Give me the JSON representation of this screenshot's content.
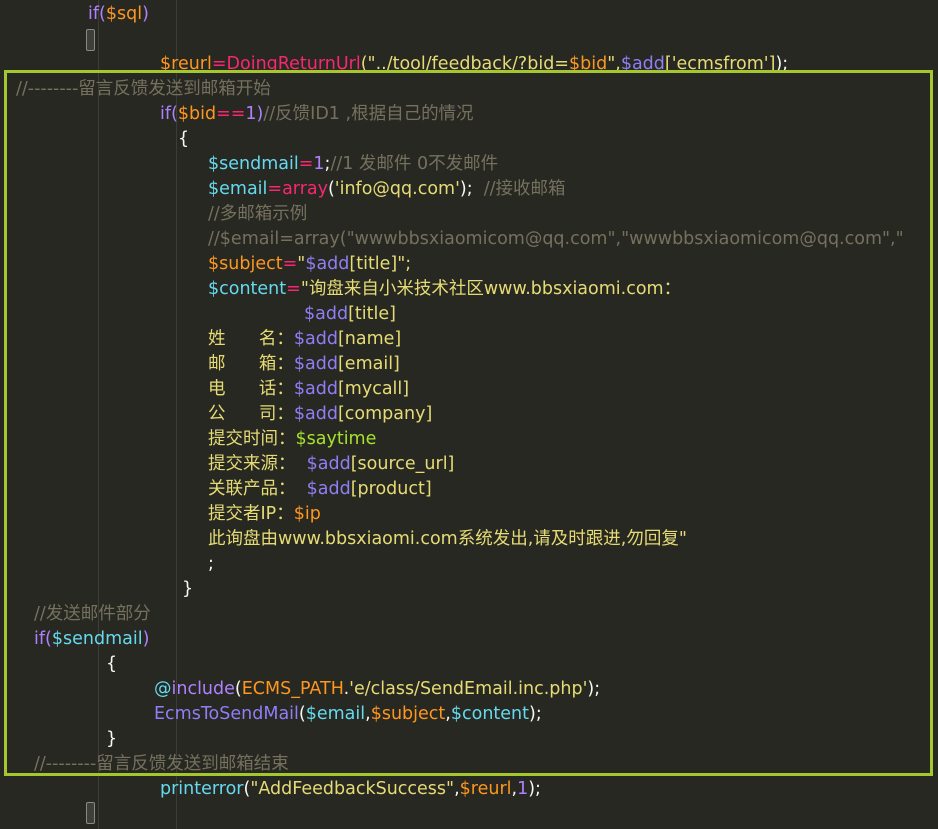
{
  "editor": {
    "theme": "dark",
    "highlight_color": "#a3c72c",
    "lines": [
      {
        "id": "l1",
        "segments": [
          {
            "t": "if(",
            "c": "kw"
          },
          {
            "t": "$sql",
            "c": "var"
          },
          {
            "t": ")",
            "c": "kw"
          }
        ]
      },
      {
        "id": "l3",
        "segments": [
          {
            "t": "$reurl",
            "c": "var"
          },
          {
            "t": "=",
            "c": "op"
          },
          {
            "t": "DoingReturnUrl",
            "c": "darkred"
          },
          {
            "t": "(\"../tool/feedback/?bid=",
            "c": "str"
          },
          {
            "t": "$bid",
            "c": "var"
          },
          {
            "t": "\",",
            "c": "str"
          },
          {
            "t": "$add",
            "c": "purple"
          },
          {
            "t": "['ecmsfrom']",
            "c": "str"
          },
          {
            "t": ");",
            "c": "white"
          }
        ]
      },
      {
        "id": "l4",
        "segments": [
          {
            "t": "//--------留言反馈发送到邮箱开始",
            "c": "cm"
          }
        ]
      },
      {
        "id": "l5",
        "segments": [
          {
            "t": "if(",
            "c": "kw"
          },
          {
            "t": "$bid",
            "c": "var"
          },
          {
            "t": "==",
            "c": "op"
          },
          {
            "t": "1",
            "c": "num"
          },
          {
            "t": ")",
            "c": "kw"
          },
          {
            "t": "//反馈ID1 ,根据自己的情况",
            "c": "cm"
          }
        ]
      },
      {
        "id": "l6",
        "segments": [
          {
            "t": "{",
            "c": "white"
          }
        ]
      },
      {
        "id": "l7",
        "segments": [
          {
            "t": "$sendmail",
            "c": "fn"
          },
          {
            "t": "=",
            "c": "op"
          },
          {
            "t": "1",
            "c": "num"
          },
          {
            "t": ";",
            "c": "white"
          },
          {
            "t": "//1 发邮件 0不发邮件",
            "c": "cm"
          }
        ]
      },
      {
        "id": "l8",
        "segments": [
          {
            "t": "$email",
            "c": "fn"
          },
          {
            "t": "=",
            "c": "op"
          },
          {
            "t": "array",
            "c": "darkred"
          },
          {
            "t": "(",
            "c": "white"
          },
          {
            "t": "'info@qq.com'",
            "c": "str"
          },
          {
            "t": ");  ",
            "c": "white"
          },
          {
            "t": "//接收邮箱",
            "c": "cm"
          }
        ]
      },
      {
        "id": "l9",
        "segments": [
          {
            "t": "//多邮箱示例",
            "c": "cm"
          }
        ]
      },
      {
        "id": "l10",
        "segments": [
          {
            "t": "//$email=array(\"wwwbbsxiaomicom@qq.com\",\"wwwbbsxiaomicom@qq.com\",\"",
            "c": "cm"
          }
        ]
      },
      {
        "id": "l11",
        "segments": [
          {
            "t": "$subject",
            "c": "var"
          },
          {
            "t": "=",
            "c": "op"
          },
          {
            "t": "\"",
            "c": "str"
          },
          {
            "t": "$add",
            "c": "purple"
          },
          {
            "t": "[title]\";",
            "c": "str"
          }
        ]
      },
      {
        "id": "l12",
        "segments": [
          {
            "t": "$content",
            "c": "fn"
          },
          {
            "t": "=",
            "c": "op"
          },
          {
            "t": "\"询盘来自小米技术社区www.bbsxiaomi.com：",
            "c": "str"
          }
        ]
      },
      {
        "id": "l13",
        "segments": [
          {
            "t": "$add",
            "c": "purple"
          },
          {
            "t": "[title]",
            "c": "str"
          }
        ]
      },
      {
        "id": "l14",
        "segments": [
          {
            "t": "姓      名：",
            "c": "str"
          },
          {
            "t": "$add",
            "c": "purple"
          },
          {
            "t": "[name]",
            "c": "str"
          }
        ]
      },
      {
        "id": "l15",
        "segments": [
          {
            "t": "邮      箱：",
            "c": "str"
          },
          {
            "t": "$add",
            "c": "purple"
          },
          {
            "t": "[email]",
            "c": "str"
          }
        ]
      },
      {
        "id": "l16",
        "segments": [
          {
            "t": "电      话：",
            "c": "str"
          },
          {
            "t": "$add",
            "c": "purple"
          },
          {
            "t": "[mycall]",
            "c": "str"
          }
        ]
      },
      {
        "id": "l17",
        "segments": [
          {
            "t": "公      司：",
            "c": "str"
          },
          {
            "t": "$add",
            "c": "purple"
          },
          {
            "t": "[company]",
            "c": "str"
          }
        ]
      },
      {
        "id": "l18",
        "segments": [
          {
            "t": "提交时间：",
            "c": "str"
          },
          {
            "t": "$saytime",
            "c": "green"
          }
        ]
      },
      {
        "id": "l19",
        "segments": [
          {
            "t": "提交来源：  ",
            "c": "str"
          },
          {
            "t": "$add",
            "c": "purple"
          },
          {
            "t": "[source_url]",
            "c": "str"
          }
        ]
      },
      {
        "id": "l20",
        "segments": [
          {
            "t": "关联产品：  ",
            "c": "str"
          },
          {
            "t": "$add",
            "c": "purple"
          },
          {
            "t": "[product]",
            "c": "str"
          }
        ]
      },
      {
        "id": "l21",
        "segments": [
          {
            "t": "提交者IP：",
            "c": "str"
          },
          {
            "t": "$ip",
            "c": "var"
          }
        ]
      },
      {
        "id": "l22",
        "segments": [
          {
            "t": "此询盘由www.bbsxiaomi.com系统发出,请及时跟进,勿回复\"",
            "c": "str"
          }
        ]
      },
      {
        "id": "l23",
        "segments": [
          {
            "t": ";",
            "c": "white"
          }
        ]
      },
      {
        "id": "l24",
        "segments": [
          {
            "t": "}",
            "c": "white"
          }
        ]
      },
      {
        "id": "l25",
        "segments": [
          {
            "t": "//发送邮件部分",
            "c": "cm"
          }
        ]
      },
      {
        "id": "l26",
        "segments": [
          {
            "t": "if(",
            "c": "kw"
          },
          {
            "t": "$sendmail",
            "c": "fn"
          },
          {
            "t": ")",
            "c": "kw"
          }
        ]
      },
      {
        "id": "l27",
        "segments": [
          {
            "t": "{",
            "c": "white"
          }
        ]
      },
      {
        "id": "l28",
        "segments": [
          {
            "t": "@",
            "c": "fn"
          },
          {
            "t": "include",
            "c": "kw"
          },
          {
            "t": "(",
            "c": "white"
          },
          {
            "t": "ECMS_PATH",
            "c": "var"
          },
          {
            "t": ".",
            "c": "white"
          },
          {
            "t": "'e/class/SendEmail.inc.php'",
            "c": "str"
          },
          {
            "t": ");",
            "c": "white"
          }
        ]
      },
      {
        "id": "l29",
        "segments": [
          {
            "t": "EcmsToSendMail",
            "c": "purple"
          },
          {
            "t": "(",
            "c": "white"
          },
          {
            "t": "$email",
            "c": "fn"
          },
          {
            "t": ",",
            "c": "white"
          },
          {
            "t": "$subject",
            "c": "var"
          },
          {
            "t": ",",
            "c": "white"
          },
          {
            "t": "$content",
            "c": "fn"
          },
          {
            "t": ");",
            "c": "white"
          }
        ]
      },
      {
        "id": "l30",
        "segments": [
          {
            "t": "}",
            "c": "white"
          }
        ]
      },
      {
        "id": "l31",
        "segments": [
          {
            "t": "//--------留言反馈发送到邮箱结束",
            "c": "cm"
          }
        ]
      },
      {
        "id": "l32",
        "segments": [
          {
            "t": "printerror",
            "c": "fn"
          },
          {
            "t": "(",
            "c": "white"
          },
          {
            "t": "\"AddFeedbackSuccess\"",
            "c": "str"
          },
          {
            "t": ",",
            "c": "white"
          },
          {
            "t": "$reurl",
            "c": "var"
          },
          {
            "t": ",",
            "c": "white"
          },
          {
            "t": "1",
            "c": "num"
          },
          {
            "t": ");",
            "c": "white"
          }
        ]
      }
    ]
  }
}
